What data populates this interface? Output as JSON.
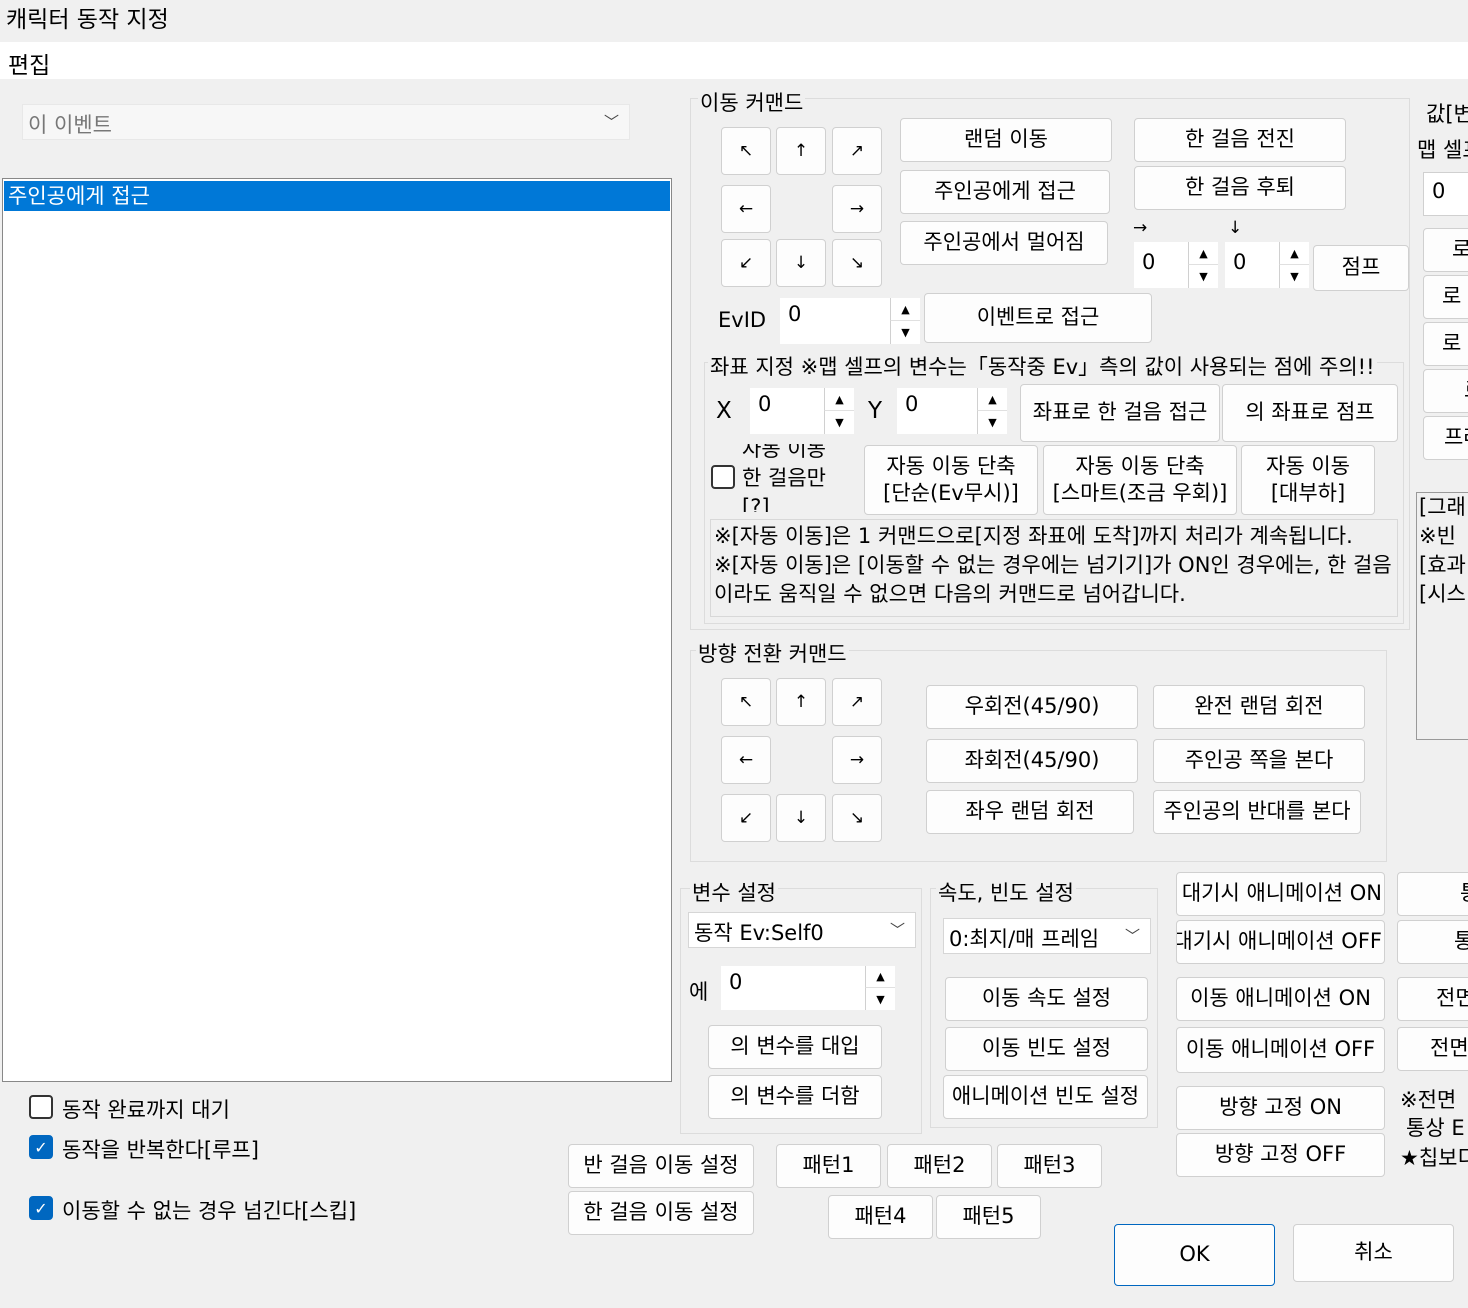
{
  "window": {
    "title": "캐릭터 동작 지정"
  },
  "menu": {
    "edit": "편집"
  },
  "target": {
    "value": "이 이벤트"
  },
  "command_list": {
    "items": [
      "주인공에게 접근"
    ]
  },
  "options": {
    "wait_label": "동작 완료까지 대기",
    "wait_checked": false,
    "loop_label": "동작을 반복한다[루프]",
    "loop_checked": true,
    "skip_label": "이동할 수 없는 경우 넘긴다[스킵]",
    "skip_checked": true
  },
  "move": {
    "group": "이동 커맨드",
    "arrows": {
      "ul": "↖",
      "u": "↑",
      "ur": "↗",
      "l": "←",
      "r": "→",
      "dl": "↙",
      "d": "↓",
      "dr": "↘"
    },
    "random": "랜덤 이동",
    "approach_hero": "주인공에게 접근",
    "away_hero": "주인공에서 멀어짐",
    "forward": "한 걸음 전진",
    "backward": "한 걸음 후퇴",
    "jump_x_arrow": "→",
    "jump_y_arrow": "↓",
    "jump_x": "0",
    "jump_y": "0",
    "jump": "점프",
    "evid_label": "EvID",
    "evid": "0",
    "approach_event": "이벤트로 접근"
  },
  "coord": {
    "group": "좌표 지정 ※맵 셀프의 변수는「동작중 Ev」측의 값이 사용되는 점에 주의!!",
    "x_label": "X",
    "x": "0",
    "y_label": "Y",
    "y": "0",
    "step_to": "좌표로 한 걸음 접근",
    "jump_to": "의 좌표로 점프",
    "auto_step_line1": "자동 이동",
    "auto_step_line2": "한 걸음만",
    "auto_step_line3": "[?]",
    "auto_simple_1": "자동 이동 단축",
    "auto_simple_2": "[단순(Ev무시)]",
    "auto_smart_1": "자동 이동 단축",
    "auto_smart_2": "[스마트(조금 우회)]",
    "auto_heavy_1": "자동 이동",
    "auto_heavy_2": "[대부하]",
    "note": "※[자동 이동]은 1 커맨드으로[지정 좌표에 도착]까지 처리가 계속됩니다.\n※[자동 이동]은 [이동할 수 없는 경우에는 넘기기]가 ON인 경우에는, 한 걸음이라도 움직일 수 없으면 다음의 커맨드로 넘어갑니다."
  },
  "turn": {
    "group": "방향 전환 커맨드",
    "rot_right": "우회전(45/90)",
    "rot_left": "좌회전(45/90)",
    "rot_lr_random": "좌우 랜덤 회전",
    "rot_random": "완전 랜덤 회전",
    "face_hero": "주인공 쪽을 본다",
    "face_away": "주인공의 반대를 본다"
  },
  "var": {
    "group": "변수 설정",
    "target": "동작 Ev:Self0",
    "at_label": "에",
    "value": "0",
    "assign": "의 변수를 대입",
    "add": "의 변수를 더함"
  },
  "speed": {
    "group": "속도, 빈도 설정",
    "value": "0:최지/매 프레임",
    "set_speed": "이동 속도 설정",
    "set_freq": "이동 빈도 설정",
    "set_anim_freq": "애니메이션 빈도 설정"
  },
  "anim": {
    "idle_on": "대기시 애니메이션 ON",
    "idle_off": "대기시 애니메이션 OFF",
    "move_on": "이동 애니메이션 ON",
    "move_off": "이동 애니메이션 OFF",
    "dir_fix_on": "방향 고정 ON",
    "dir_fix_off": "방향 고정 OFF"
  },
  "misc": {
    "half_step": "반 걸음 이동 설정",
    "full_step": "한 걸음 이동 설정",
    "p1": "패턴1",
    "p2": "패턴2",
    "p3": "패턴3",
    "p4": "패턴4",
    "p5": "패턴5"
  },
  "right_partial": {
    "value_label": "값[변",
    "map_self": "맵 셀프",
    "value": "0",
    "b1": "로",
    "b2": "로",
    "b3": "로",
    "b4": "로",
    "b5": "프레",
    "info1": "[그래",
    "info2": "※빈",
    "info3": "[효과",
    "info4": "[시스",
    "t1": "통",
    "t2": "통",
    "front1": "전면",
    "front2": "전면",
    "note1": "※전면",
    "note2": "통상 E",
    "note3": "★칩보디"
  },
  "dialog": {
    "ok": "OK",
    "cancel": "취소"
  }
}
